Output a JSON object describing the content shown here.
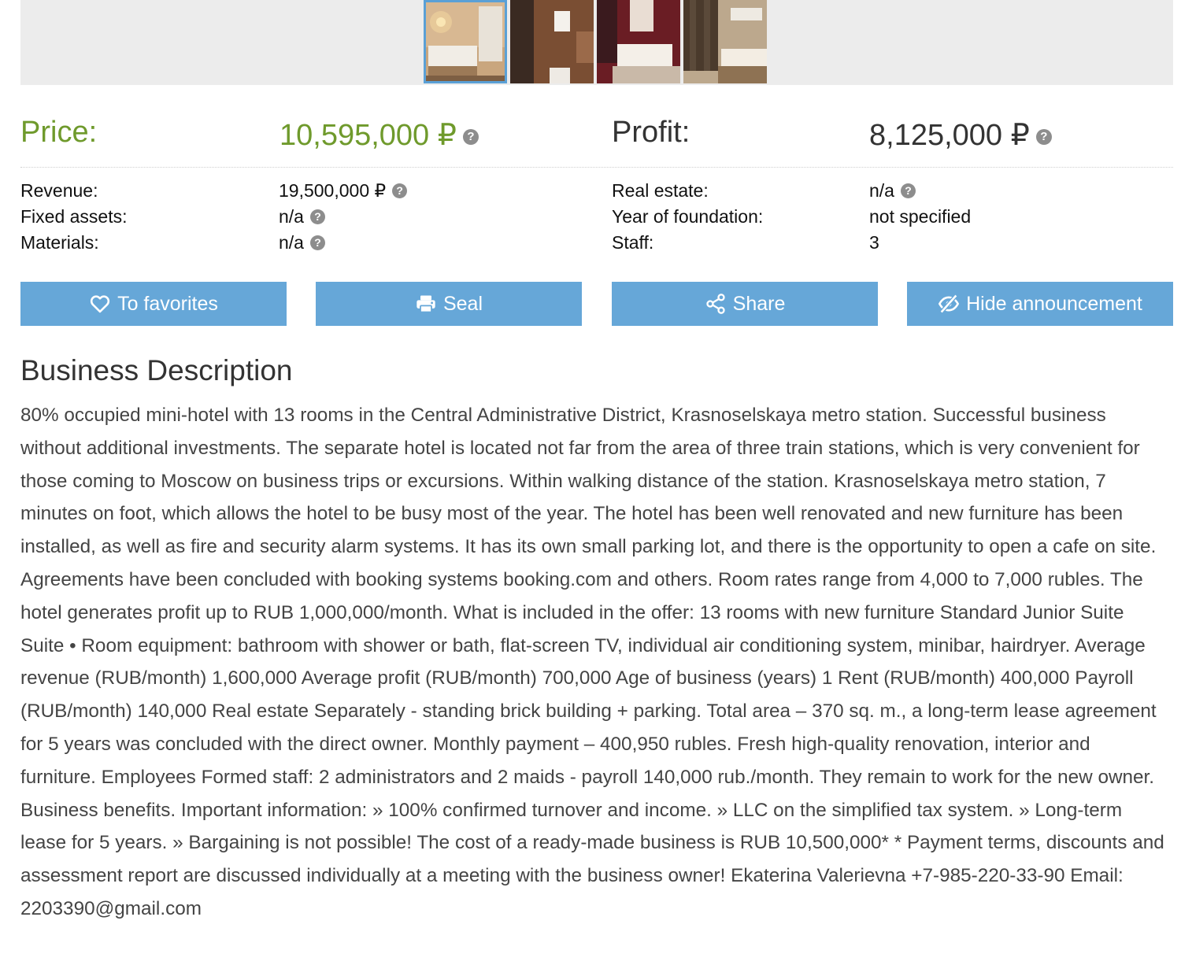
{
  "gallery": {
    "thumbnails": [
      {
        "icon": "bedroom-photo",
        "active": true
      },
      {
        "icon": "bathroom-photo",
        "active": false
      },
      {
        "icon": "red-bedroom-photo",
        "active": false
      },
      {
        "icon": "curtained-bedroom-photo",
        "active": false
      }
    ]
  },
  "summary": {
    "price_label": "Price:",
    "price_value": "10,595,000 ₽",
    "profit_label": "Profit:",
    "profit_value": "8,125,000 ₽",
    "help_glyph": "?"
  },
  "details": {
    "left": [
      {
        "label": "Revenue:",
        "value": "19,500,000 ₽",
        "help": true
      },
      {
        "label": "Fixed assets:",
        "value": "n/a",
        "help": true
      },
      {
        "label": "Materials:",
        "value": "n/a",
        "help": true
      }
    ],
    "right": [
      {
        "label": "Real estate:",
        "value": "n/a",
        "help": true
      },
      {
        "label": "Year of foundation:",
        "value": "not specified",
        "help": false
      },
      {
        "label": "Staff:",
        "value": "3",
        "help": false
      }
    ]
  },
  "actions": {
    "favorites_label": "To favorites",
    "seal_label": "Seal",
    "share_label": "Share",
    "hide_label": "Hide announcement"
  },
  "description": {
    "title": "Business Description",
    "text": "80% occupied mini-hotel with 13 rooms in the Central Administrative District, Krasnoselskaya metro station. Successful business without additional investments. The separate hotel is located not far from the area of three train stations, which is very convenient for those coming to Moscow on business trips or excursions. Within walking distance of the station. Krasnoselskaya metro station, 7 minutes on foot, which allows the hotel to be busy most of the year. The hotel has been well renovated and new furniture has been installed, as well as fire and security alarm systems. It has its own small parking lot, and there is the opportunity to open a cafe on site. Agreements have been concluded with booking systems booking.com and others. Room rates range from 4,000 to 7,000 rubles. The hotel generates profit up to RUB 1,000,000/month. What is included in the offer: 13 rooms with new furniture  Standard  Junior Suite  Suite • Room equipment: bathroom with shower or bath, flat-screen TV, individual air conditioning system, minibar, hairdryer. Average revenue (RUB/month) 1,600,000 Average profit (RUB/month) 700,000 Age of business (years) 1 Rent (RUB/month) 400,000 Payroll (RUB/month) 140,000 Real estate Separately - standing brick building + parking. Total area – 370 sq. m., a long-term lease agreement for 5 years was concluded with the direct owner. Monthly payment – 400,950 rubles. Fresh high-quality renovation, interior and furniture. Employees Formed staff: 2 administrators and 2 maids - payroll 140,000 rub./month. They remain to work for the new owner. Business benefits. Important information: » 100% confirmed turnover and income. » LLC on the simplified tax system. » Long-term lease for 5 years. » Bargaining is not possible! The cost of a ready-made business is RUB 10,500,000* * Payment terms, discounts and assessment report are discussed individually at a meeting with the business owner! Ekaterina Valerievna +7-985-220-33-90 Email: 2203390@gmail.com"
  },
  "colors": {
    "price_green": "#6f9a2c",
    "button_blue": "#66a7d8",
    "gallery_bg": "#ececec"
  }
}
